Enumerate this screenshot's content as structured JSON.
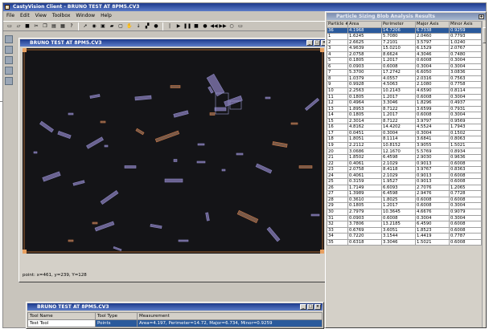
{
  "app": {
    "title": "CastyVision Client - BRUNO TEST AT 8PM5.CV3",
    "menus": [
      "File",
      "Edit",
      "View",
      "Toolbox",
      "Window",
      "Help"
    ]
  },
  "toolbar": {
    "icons": [
      "new-file-icon",
      "open-folder-icon",
      "save-icon",
      "cut-icon",
      "copy-icon",
      "paste-icon",
      "print-icon",
      "help-icon",
      "pointer-icon",
      "camera-icon",
      "image-icon",
      "folder-icon",
      "frame-icon",
      "grab-icon",
      "down-arrow-icon",
      "threshold-icon",
      "circle-tool-icon",
      "separator-icon",
      "play-icon",
      "pause-icon",
      "stop-icon",
      "record-icon",
      "rewind-icon",
      "fast-forward-icon",
      "loop-icon",
      "frame-view-icon"
    ]
  },
  "image_window": {
    "title": "BRUNO TEST AT 8PM5.CV3",
    "status": "point: x=461, y=239, Y=128"
  },
  "measure_window": {
    "title": "BRUNO TEST AT 8PM5.CV3",
    "headers": [
      "Tool Name",
      "Tool Type",
      "Measurement"
    ],
    "rows": [
      [
        "Test Tool",
        "Points",
        "Area=4.197, Perimeter=14.72, Major=6.734, Minor=0.9259"
      ]
    ]
  },
  "results_window": {
    "title": "Particle Sizing Blob Analysis Results",
    "headers": [
      "Particle #",
      "Area",
      "Perimeter",
      "Major Axis",
      "Minor Axis"
    ],
    "rows": [
      [
        "36",
        "4.1968",
        "14.7206",
        "6.7338",
        "0.9259"
      ],
      [
        "1",
        "1.6245",
        "5.7080",
        "2.0460",
        "0.7793"
      ],
      [
        "2",
        "2.6625",
        "7.2101",
        "3.5797",
        "1.0240"
      ],
      [
        "3",
        "4.9639",
        "15.0210",
        "6.1529",
        "2.0767"
      ],
      [
        "4",
        "2.0758",
        "8.6624",
        "4.3046",
        "0.7480"
      ],
      [
        "5",
        "0.1805",
        "1.2017",
        "0.6008",
        "0.3004"
      ],
      [
        "6",
        "0.0903",
        "0.6008",
        "0.3004",
        "0.3004"
      ],
      [
        "7",
        "5.3700",
        "17.2742",
        "6.6050",
        "3.0836"
      ],
      [
        "8",
        "1.0379",
        "4.0557",
        "2.0316",
        "0.7563"
      ],
      [
        "9",
        "0.9928",
        "4.5063",
        "2.1080",
        "0.7758"
      ],
      [
        "10",
        "2.2563",
        "10.2143",
        "4.6590",
        "0.8114"
      ],
      [
        "11",
        "0.1805",
        "1.2017",
        "0.6008",
        "0.3004"
      ],
      [
        "12",
        "0.4964",
        "3.3046",
        "1.8296",
        "0.4937"
      ],
      [
        "13",
        "1.8953",
        "8.7122",
        "3.6599",
        "0.7931"
      ],
      [
        "14",
        "0.1805",
        "1.2017",
        "0.6008",
        "0.3004"
      ],
      [
        "15",
        "2.3014",
        "8.7122",
        "3.9797",
        "0.9569"
      ],
      [
        "16",
        "4.8162",
        "14.4202",
        "4.5524",
        "1.7943"
      ],
      [
        "17",
        "0.0451",
        "0.3004",
        "0.3004",
        "0.1502"
      ],
      [
        "18",
        "1.8051",
        "8.1114",
        "3.6841",
        "0.8063"
      ],
      [
        "19",
        "2.2112",
        "10.8152",
        "3.9055",
        "1.5021"
      ],
      [
        "20",
        "3.0686",
        "12.1670",
        "5.5769",
        "0.8934"
      ],
      [
        "21",
        "1.8502",
        "6.4598",
        "2.9030",
        "0.9636"
      ],
      [
        "22",
        "0.4061",
        "2.1029",
        "0.9013",
        "0.6008"
      ],
      [
        "23",
        "2.0758",
        "8.4118",
        "3.9767",
        "0.8363"
      ],
      [
        "24",
        "0.4061",
        "2.1029",
        "0.9013",
        "0.6008"
      ],
      [
        "25",
        "0.3159",
        "1.9527",
        "0.9013",
        "0.6008"
      ],
      [
        "26",
        "1.7149",
        "6.6093",
        "2.7076",
        "1.2065"
      ],
      [
        "27",
        "1.3989",
        "6.4598",
        "2.9476",
        "0.7728"
      ],
      [
        "28",
        "0.3610",
        "1.8025",
        "0.6008",
        "0.6008"
      ],
      [
        "29",
        "0.1805",
        "1.2017",
        "0.6008",
        "0.3004"
      ],
      [
        "30",
        "2.7979",
        "10.3645",
        "4.6676",
        "0.9079"
      ],
      [
        "31",
        "0.0903",
        "0.6008",
        "0.3004",
        "0.3004"
      ],
      [
        "32",
        "3.7806",
        "13.2185",
        "6.4590",
        "0.6008"
      ],
      [
        "33",
        "0.6769",
        "3.6051",
        "1.8523",
        "0.6008"
      ],
      [
        "34",
        "0.7220",
        "3.1544",
        "1.4419",
        "0.7787"
      ],
      [
        "35",
        "0.6318",
        "3.3046",
        "1.5021",
        "0.6008"
      ]
    ]
  }
}
